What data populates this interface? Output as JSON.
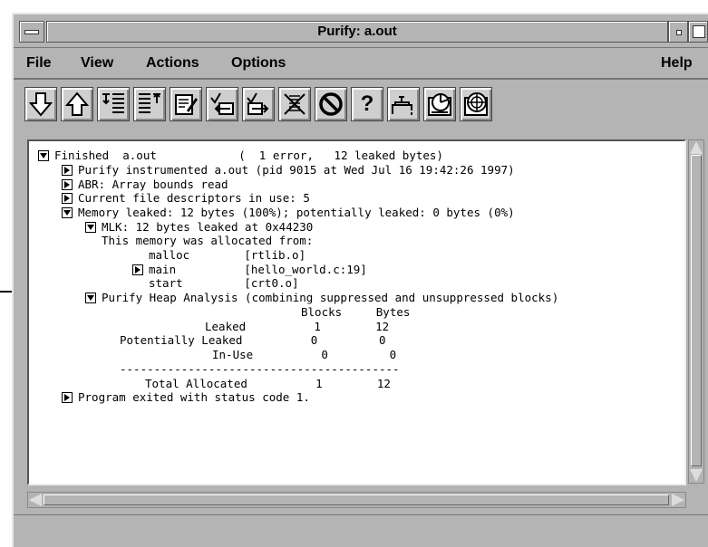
{
  "window": {
    "title": "Purify: a.out"
  },
  "menubar": {
    "file": "File",
    "view": "View",
    "actions": "Actions",
    "options": "Options",
    "help": "Help"
  },
  "toolbar": {
    "icons": [
      "arrow-down-icon",
      "arrow-up-icon",
      "expand-all-icon",
      "collapse-all-icon",
      "edit-icon",
      "suppress-icon",
      "unsuppress-icon",
      "kill-icon",
      "stop-icon",
      "help-icon",
      "plumbing-icon",
      "heap-analysis-icon",
      "memory-target-icon"
    ],
    "help_label": "?"
  },
  "report": {
    "l0": "Finished  a.out            (  1 error,   12 leaked bytes)",
    "l1": "Purify instrumented a.out (pid 9015 at Wed Jul 16 19:42:26 1997)",
    "l2": "ABR: Array bounds read",
    "l3": "Current file descriptors in use: 5",
    "l4": "Memory leaked: 12 bytes (100%); potentially leaked: 0 bytes (0%)",
    "l5": "MLK: 12 bytes leaked at 0x44230",
    "l6": "This memory was allocated from:",
    "l7": "malloc        [rtlib.o]",
    "l8": "main          [hello_world.c:19]",
    "l9": "start         [crt0.o]",
    "l10": "Purify Heap Analysis (combining suppressed and unsuppressed blocks)",
    "l11": "Blocks     Bytes",
    "l12": "Leaked          1        12",
    "l13": "Potentially Leaked          0         0",
    "l14": "In-Use          0         0",
    "l15": "-----------------------------------------",
    "l16": "Total Allocated          1        12",
    "l17": "Program exited with status code 1."
  },
  "colors": {
    "chrome": "#b4b4b4",
    "background": "#ffffff",
    "text": "#000000"
  }
}
